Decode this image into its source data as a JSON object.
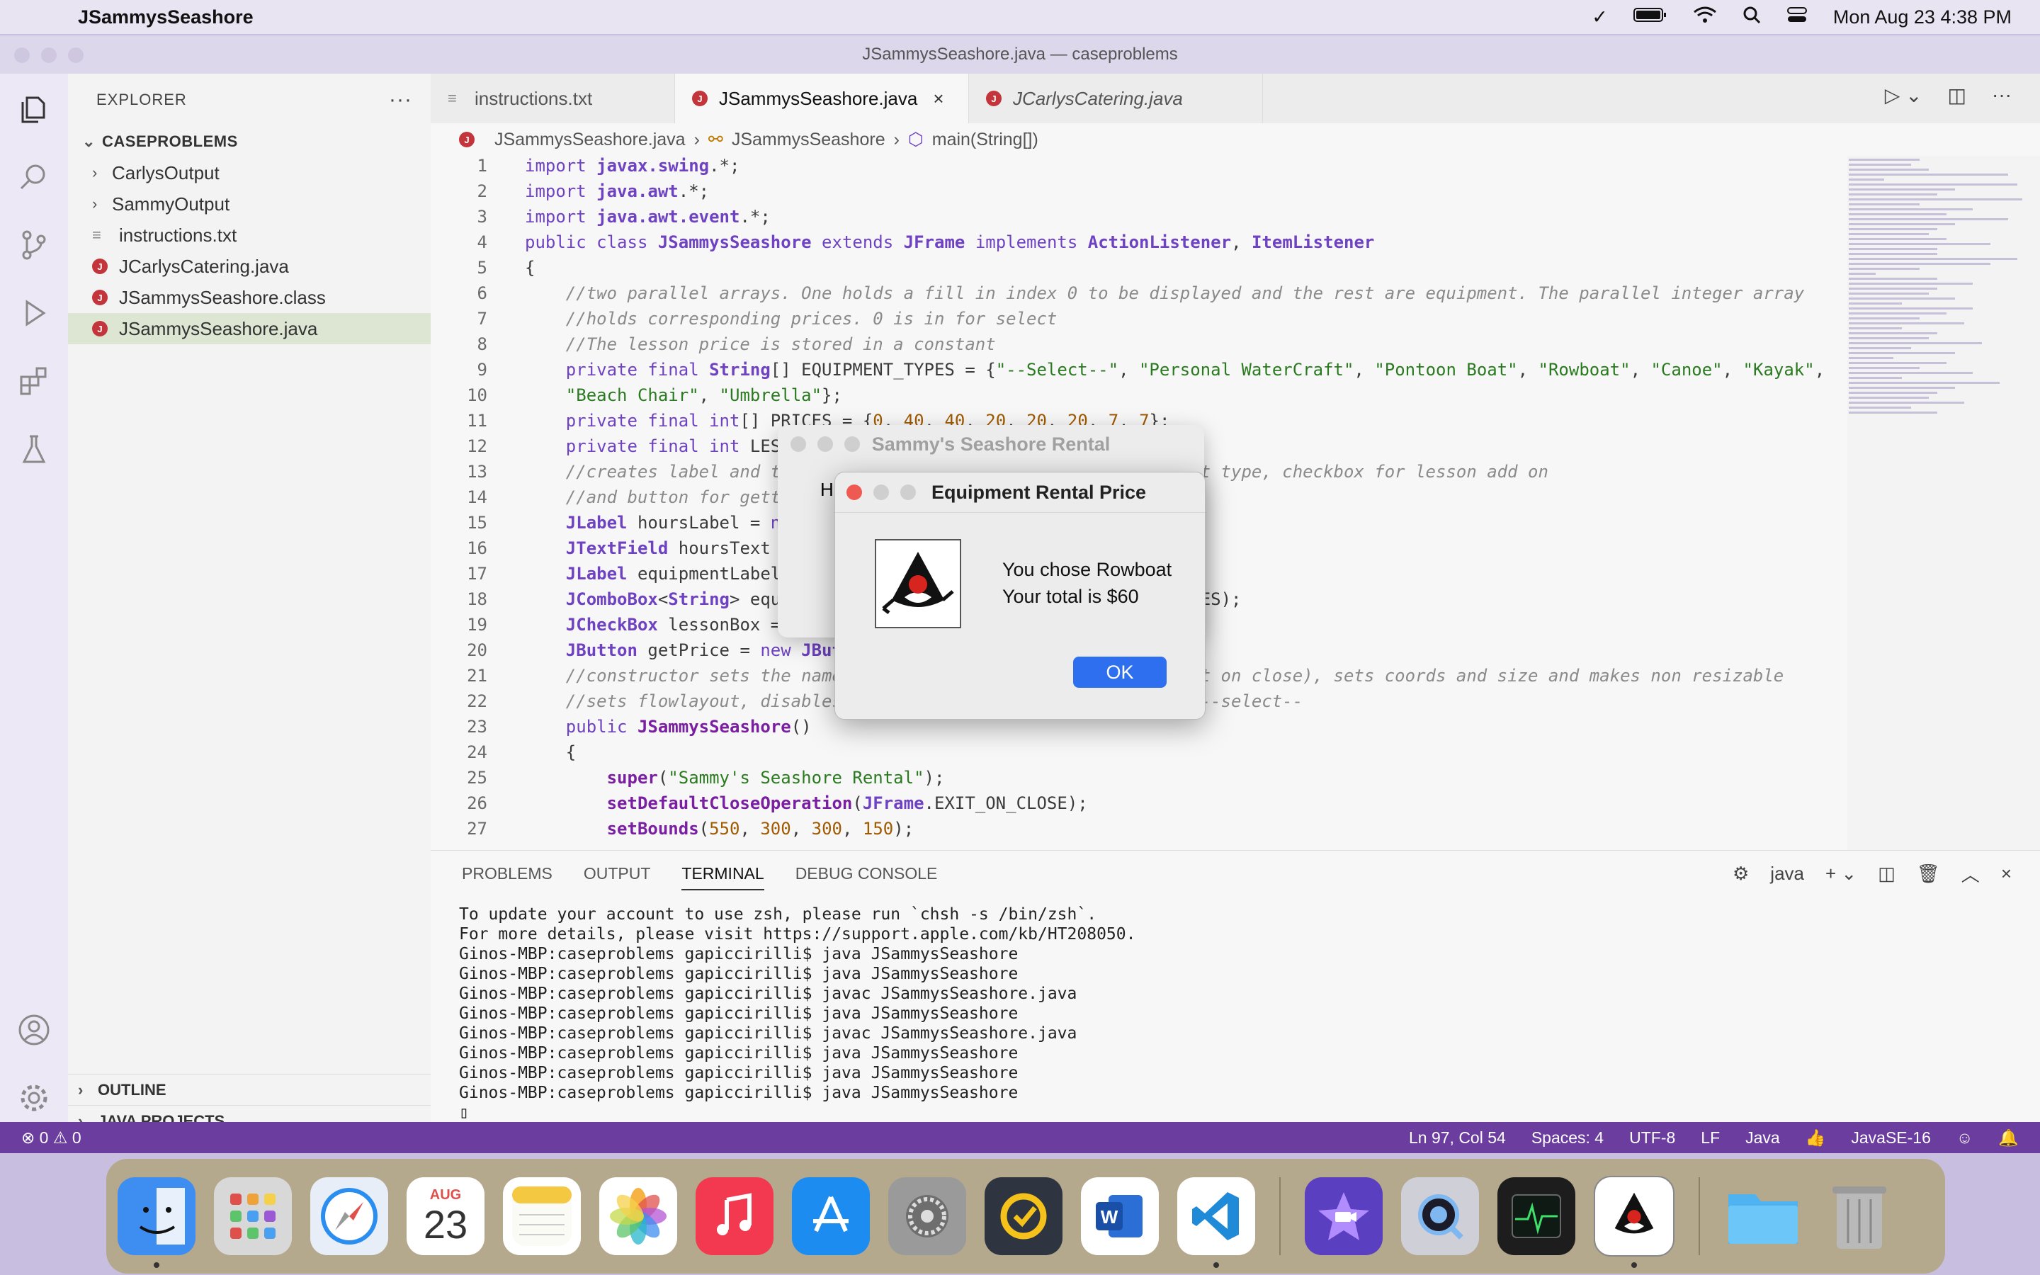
{
  "menubar": {
    "app_name": "JSammysSeashore",
    "clock": "Mon Aug 23  4:38 PM"
  },
  "window": {
    "title": "JSammysSeashore.java — caseproblems"
  },
  "sidebar": {
    "header": "EXPLORER",
    "project": "CASEPROBLEMS",
    "items": [
      {
        "label": "CarlysOutput",
        "kind": "folder"
      },
      {
        "label": "SammyOutput",
        "kind": "folder"
      },
      {
        "label": "instructions.txt",
        "kind": "text"
      },
      {
        "label": "JCarlysCatering.java",
        "kind": "java"
      },
      {
        "label": "JSammysSeashore.class",
        "kind": "java"
      },
      {
        "label": "JSammysSeashore.java",
        "kind": "java"
      }
    ],
    "outline": "OUTLINE",
    "java_projects": "JAVA PROJECTS"
  },
  "tabs": [
    {
      "label": "instructions.txt"
    },
    {
      "label": "JSammysSeashore.java"
    },
    {
      "label": "JCarlysCatering.java"
    }
  ],
  "breadcrumb": [
    "JSammysSeashore.java",
    "JSammysSeashore",
    "main(String[])"
  ],
  "code_lines": [
    "1",
    "2",
    "3",
    "4",
    "5",
    "6",
    "7",
    "8",
    "9",
    "10",
    "11",
    "12",
    "13",
    "14",
    "15",
    "16",
    "17",
    "18",
    "19",
    "20",
    "21",
    "22",
    "23",
    "24",
    "25",
    "26",
    "27"
  ],
  "panel": {
    "tabs": [
      "PROBLEMS",
      "OUTPUT",
      "TERMINAL",
      "DEBUG CONSOLE"
    ],
    "shell_label": "java",
    "terminal_lines": [
      "To update your account to use zsh, please run `chsh -s /bin/zsh`.",
      "For more details, please visit https://support.apple.com/kb/HT208050.",
      "Ginos-MBP:caseproblems gapiccirilli$ java JSammysSeashore",
      "Ginos-MBP:caseproblems gapiccirilli$ java JSammysSeashore",
      "Ginos-MBP:caseproblems gapiccirilli$ javac JSammysSeashore.java",
      "Ginos-MBP:caseproblems gapiccirilli$ java JSammysSeashore",
      "Ginos-MBP:caseproblems gapiccirilli$ javac JSammysSeashore.java",
      "Ginos-MBP:caseproblems gapiccirilli$ java JSammysSeashore",
      "Ginos-MBP:caseproblems gapiccirilli$ java JSammysSeashore",
      "Ginos-MBP:caseproblems gapiccirilli$ java JSammysSeashore"
    ]
  },
  "statusbar": {
    "problems": "⊗ 0 ⚠ 0",
    "position": "Ln 97, Col 54",
    "spaces": "Spaces: 4",
    "encoding": "UTF-8",
    "eol": "LF",
    "language": "Java",
    "jdk": "JavaSE-16"
  },
  "dialog_back": {
    "title": "Sammy's Seashore Rental",
    "peek": "H"
  },
  "dialog": {
    "title": "Equipment Rental Price",
    "line1": "You chose Rowboat",
    "line2": "Your total is $60",
    "ok": "OK"
  },
  "dock": {
    "calendar_month": "AUG",
    "calendar_day": "23"
  },
  "colors": {
    "status_bar": "#6a3d9f",
    "dialog_button": "#2e6ff0",
    "java_icon": "#c4343b"
  }
}
